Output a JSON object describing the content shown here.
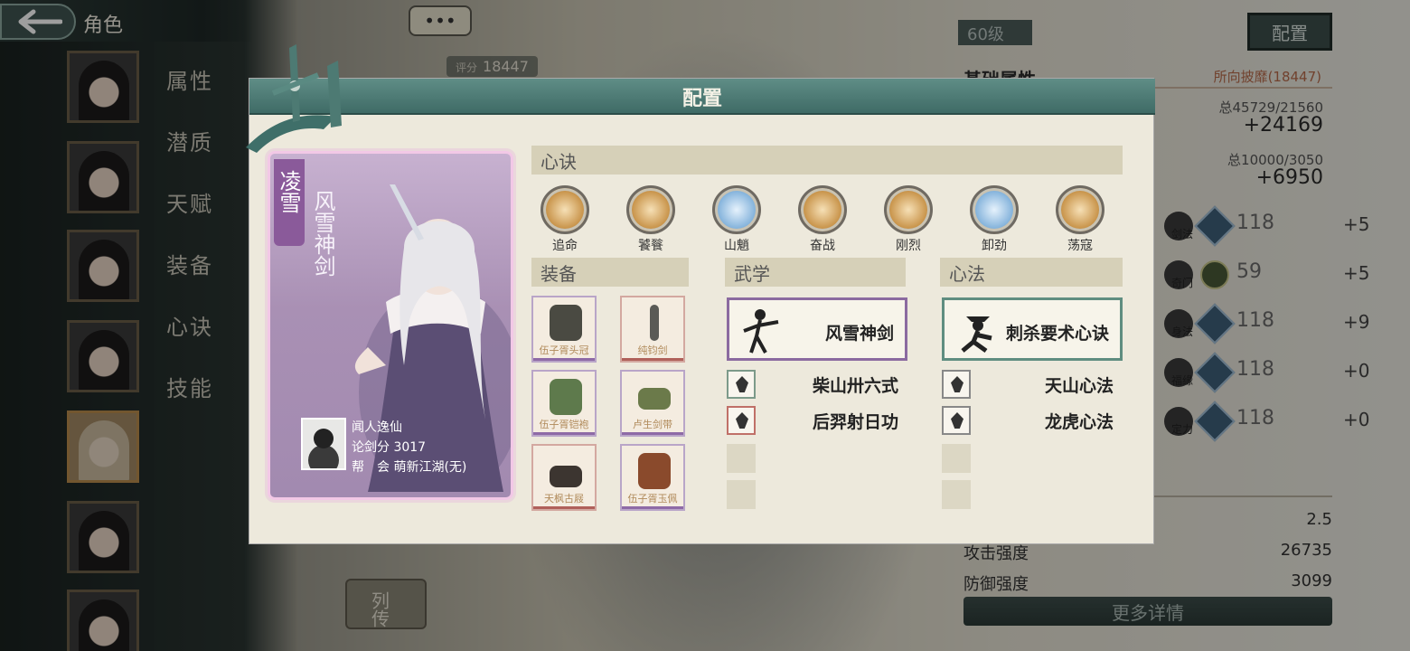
{
  "topbar": {
    "title": "角色"
  },
  "side_menu": [
    "属性",
    "潜质",
    "天赋",
    "装备",
    "心诀",
    "技能"
  ],
  "chat_label": "•••",
  "score": {
    "label": "评分",
    "value": "18447"
  },
  "liezhuan": "列传",
  "right_panel": {
    "level": "60级",
    "config_button": "配置",
    "base_attr_title": "基础属性",
    "power": "所向披靡(18447)",
    "total1": "总45729/21560",
    "big1": "+24169",
    "total2": "总10000/3050",
    "big2": "+6950",
    "attrs": [
      {
        "name": "剑法",
        "grade": "118",
        "plus": "+5"
      },
      {
        "name": "奇门",
        "grade": "59",
        "badge": "丙",
        "plus": "+5"
      },
      {
        "name": "身法",
        "grade": "118",
        "plus": "+9"
      },
      {
        "name": "福缘",
        "grade": "118",
        "plus": "+0"
      },
      {
        "name": "定力",
        "grade": "118",
        "plus": "+0"
      }
    ],
    "stats": [
      {
        "label": "",
        "value": "2.5"
      },
      {
        "label": "攻击强度",
        "value": "26735"
      },
      {
        "label": "防御强度",
        "value": "3099"
      }
    ],
    "more_button": "更多详情"
  },
  "dialog": {
    "title": "配置",
    "card": {
      "name": "凌雪",
      "title": "风雪神剑",
      "owner": {
        "name": "闻人逸仙",
        "score_label": "论剑分",
        "score": "3017",
        "guild_label": "帮　会",
        "guild": "萌新江湖(无)"
      }
    },
    "xinjue_header": "心诀",
    "skills": [
      "追命",
      "饕餮",
      "山魈",
      "奋战",
      "刚烈",
      "卸劲",
      "荡寇"
    ],
    "equip_header": "装备",
    "equipment": [
      "伍子胥头冠",
      "纯钧剑",
      "伍子胥铠袍",
      "卢生剑带",
      "天枫古屐",
      "伍子胥玉佩"
    ],
    "wuxue_header": "武学",
    "wuxue_main": "风雪神剑",
    "wuxue_sub": [
      "柴山卅六式",
      "后羿射日功"
    ],
    "xinfa_header": "心法",
    "xinfa_main": "刺杀要术心诀",
    "xinfa_sub": [
      "天山心法",
      "龙虎心法"
    ]
  },
  "colors": {
    "teal_header": "#4f7d77",
    "accent_purple": "#8b6aa0",
    "accent_green": "#5f8d80"
  }
}
